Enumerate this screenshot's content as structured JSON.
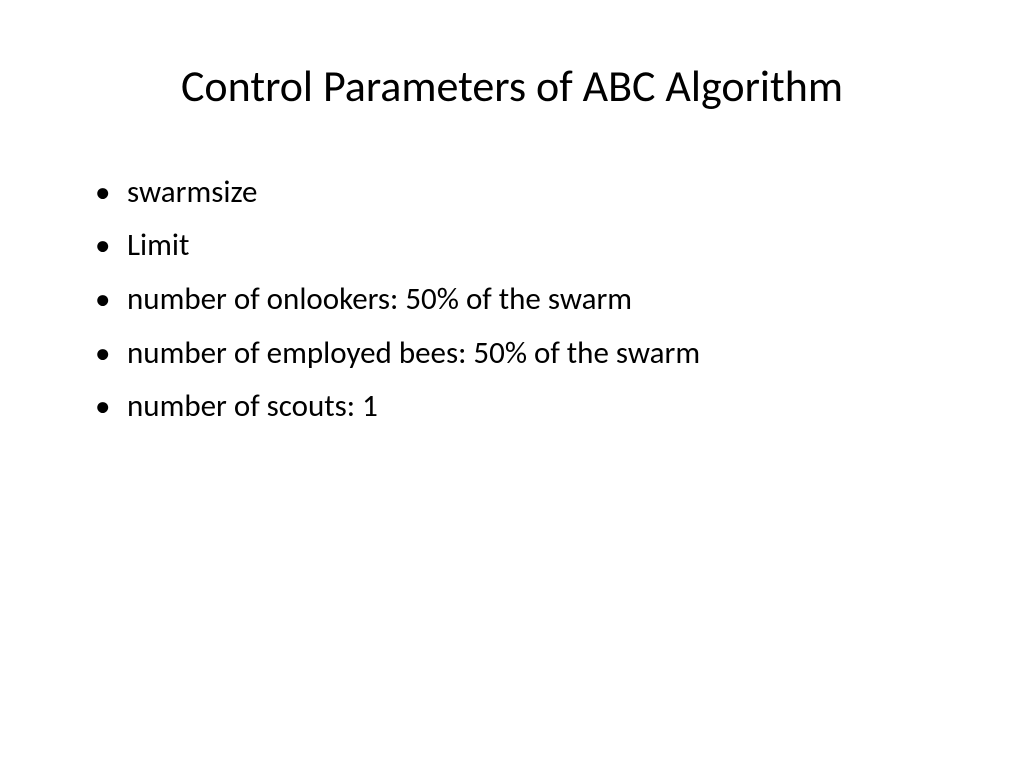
{
  "slide": {
    "title": "Control Parameters of ABC Algorithm",
    "bullets": [
      "swarmsize",
      "Limit",
      "number of onlookers: 50% of the swarm",
      "number of employed bees: 50% of the swarm",
      "number of scouts: 1"
    ]
  }
}
